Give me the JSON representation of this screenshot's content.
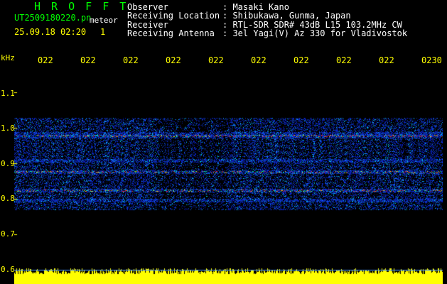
{
  "header": {
    "app_name": "H R O F F T",
    "file_name": "UT2509180220.pn",
    "file_name_suffix": "meteor",
    "datetime": "25.09.18 02:20",
    "counter": "1",
    "fields": [
      {
        "label": "Observer",
        "value": ": Masaki Kano"
      },
      {
        "label": "Receiving Location",
        "value": ": Shibukawa, Gunma, Japan"
      },
      {
        "label": "Receiver",
        "value": ": RTL-SDR SDR# 43dB L15 103.2MHz CW"
      },
      {
        "label": "Receiving Antenna",
        "value": ": 3el Yagi(V) Az 330 for Vladivostok"
      }
    ]
  },
  "axes": {
    "y_unit": "kHz",
    "y_ticks": [
      "1.1",
      "1.0",
      "0.9",
      "0.8",
      "0.7",
      "0.6"
    ],
    "x_ticks": [
      "022",
      "022",
      "022",
      "022",
      "022",
      "022",
      "022",
      "022",
      "022",
      "0230"
    ]
  },
  "colors": {
    "header_green": "#00ff00",
    "header_text": "#ffffff",
    "axis_yellow": "#ffff00",
    "background": "#000000",
    "signal_blue": "#1020d0",
    "signal_red": "#ff2020"
  }
}
